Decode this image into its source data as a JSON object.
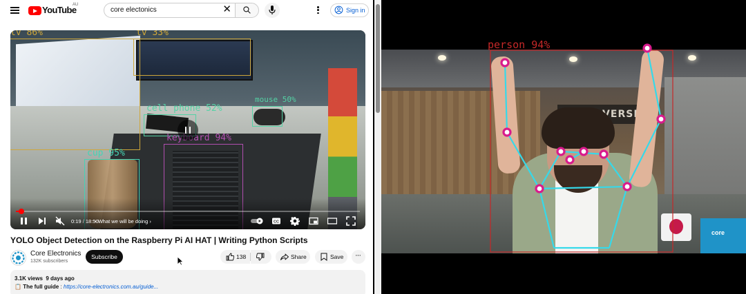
{
  "youtube": {
    "logo_text": "YouTube",
    "country_code": "AU",
    "search": {
      "query": "core electonics"
    },
    "sign_in_label": "Sign in",
    "player": {
      "state": "playing",
      "current_time": "0:19",
      "separator": " / ",
      "duration": "18:50",
      "chapter": "• What we will be doing",
      "progress_fraction": 0.017,
      "detections": [
        {
          "label": "tv 86%",
          "color": "#cfa73a"
        },
        {
          "label": "tv 33%",
          "color": "#cfa73a"
        },
        {
          "label": "cell phone 52%",
          "color": "#54d2a5"
        },
        {
          "label": "mouse 50%",
          "color": "#54d2a5"
        },
        {
          "label": "keyboard 94%",
          "color": "#b24fb0"
        },
        {
          "label": "cup 95%",
          "color": "#46d4b4"
        }
      ]
    },
    "video": {
      "title": "YOLO Object Detection on the Raspberry Pi AI HAT | Writing Python Scripts",
      "channel_name": "Core Electronics",
      "subscribers": "132K subscribers",
      "subscribe_label": "Subscribe",
      "likes": "138",
      "share_label": "Share",
      "save_label": "Save",
      "views": "3.1K views",
      "age": "9 days ago",
      "desc_icon": "📋",
      "desc_label": "The full guide",
      "desc_sep": " : ",
      "desc_link": "https://core-electronics.com.au/guide..."
    }
  },
  "pose_video": {
    "person_label": "person 94%",
    "box_color": "#c62828",
    "skeleton_color": "#35d9ea",
    "keypoint_color": "#d81b8c",
    "sign_text": "MAKERVERSE",
    "box_brand_text": "core"
  }
}
